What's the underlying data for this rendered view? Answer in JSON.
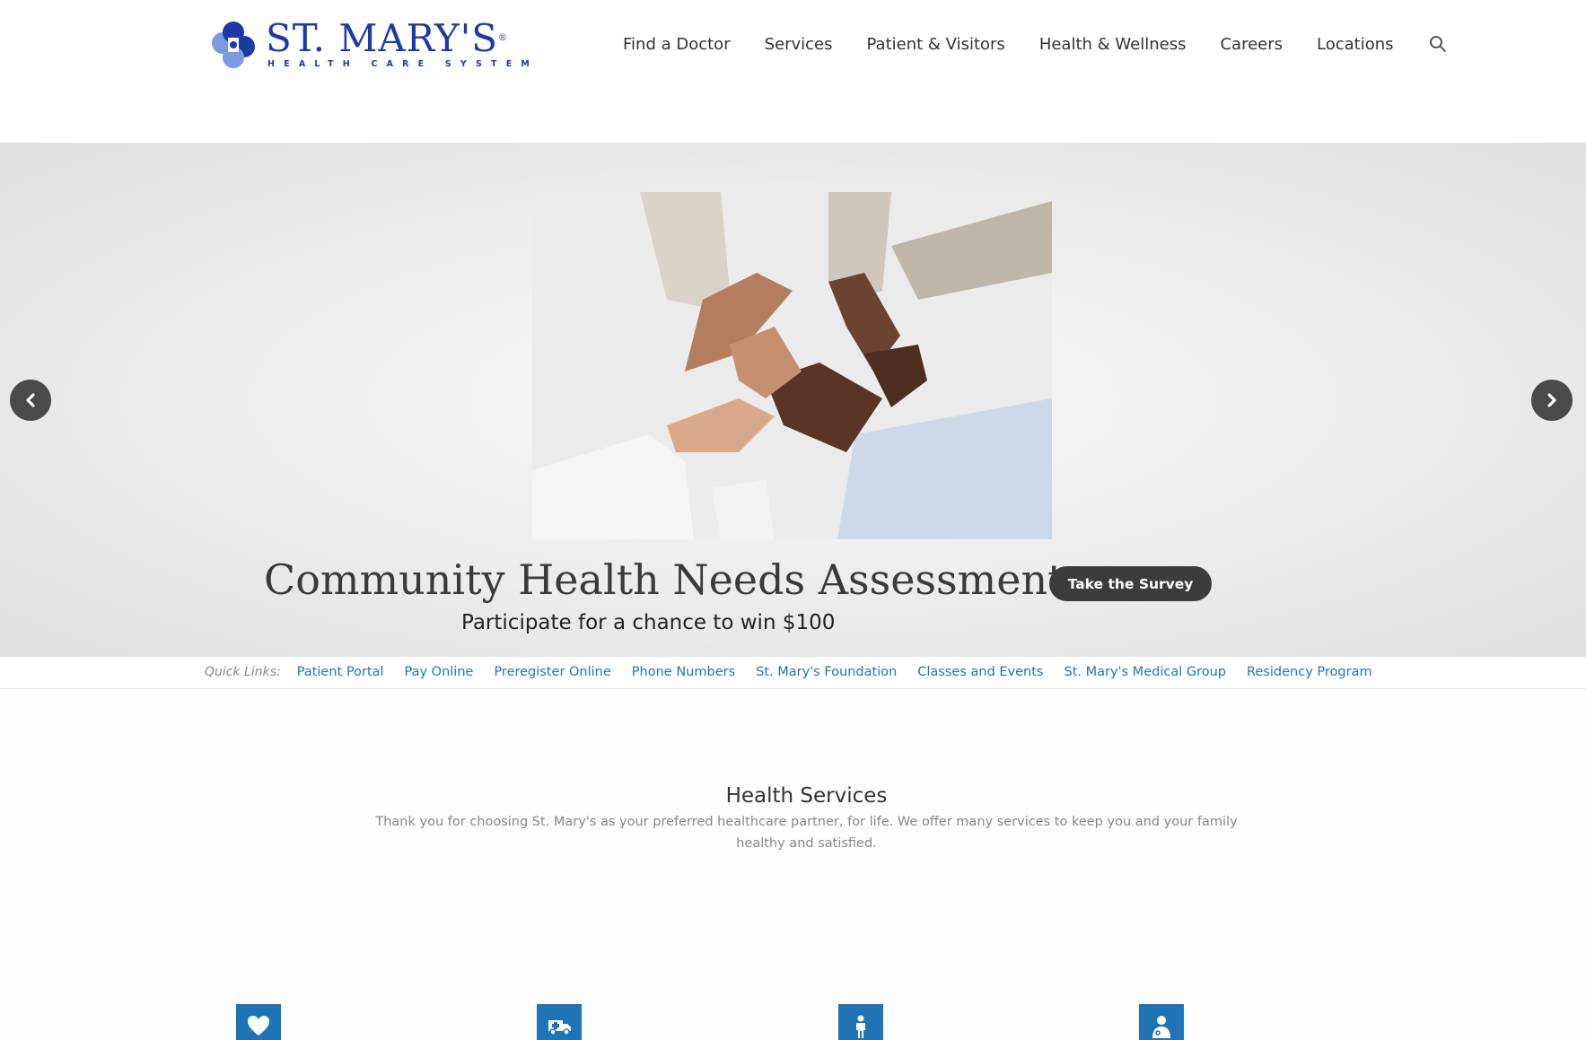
{
  "brand": {
    "name": "ST. MARY'S",
    "registered": "®",
    "tagline": "HEALTH CARE SYSTEM",
    "color": "#1b3aa8"
  },
  "nav": {
    "items": [
      "Find a Doctor",
      "Services",
      "Patient & Visitors",
      "Health & Wellness",
      "Careers",
      "Locations"
    ],
    "search_icon": "search-icon"
  },
  "hero": {
    "heading": "Community Health Needs Assessment:",
    "subheading": "Participate for a chance to win $100",
    "button_label": "Take the Survey",
    "prev_icon": "chevron-left-icon",
    "next_icon": "chevron-right-icon"
  },
  "quick_links": {
    "label": "Quick Links:",
    "links": [
      "Patient Portal",
      "Pay Online",
      "Preregister Online",
      "Phone Numbers",
      "St. Mary's Foundation",
      "Classes and Events",
      "St. Mary's Medical Group",
      "Residency Program"
    ]
  },
  "health_services": {
    "title": "Health Services",
    "description": "Thank you for choosing St. Mary's as your preferred healthcare partner, for life. We offer many services to keep you and your family healthy and satisfied.",
    "icons": [
      "heart-icon",
      "ambulance-icon",
      "person-icon",
      "doctor-icon"
    ],
    "accent": "#1f74b5"
  }
}
